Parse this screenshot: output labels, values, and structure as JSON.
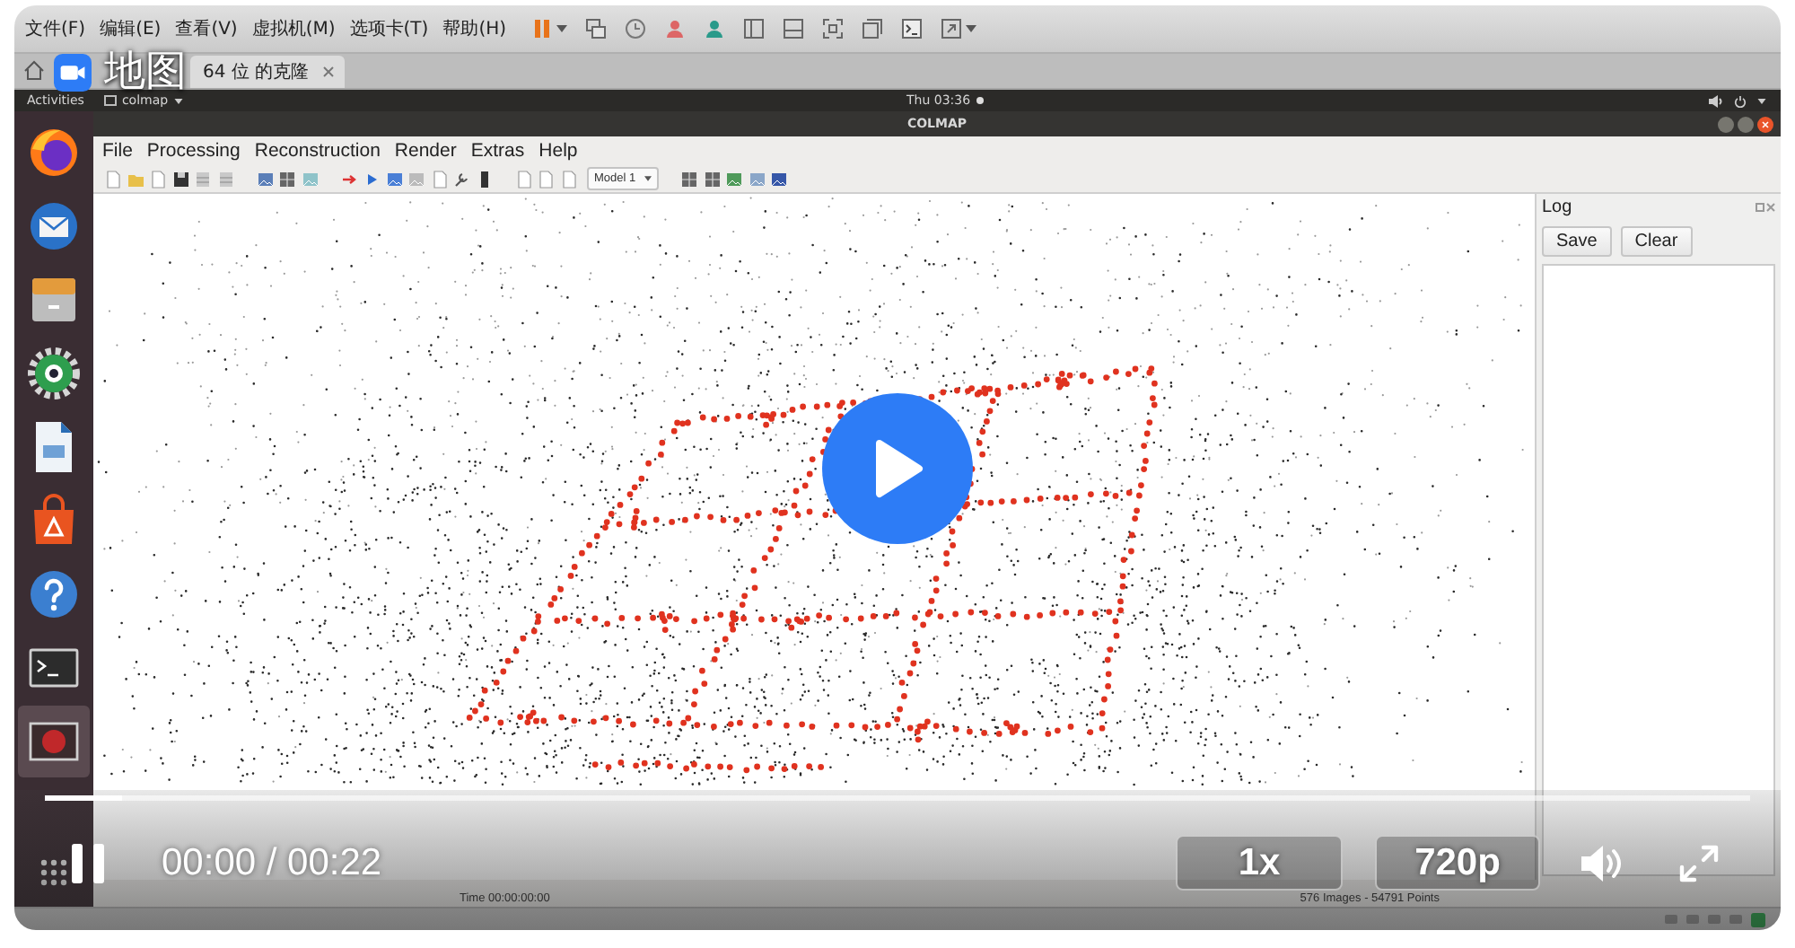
{
  "vm_menu": [
    "文件(F)",
    "编辑(E)",
    "查看(V)",
    "虚拟机(M)",
    "选项卡(T)",
    "帮助(H)"
  ],
  "vm_tabs": [
    {
      "kind": "home",
      "selected": false
    },
    {
      "kind": "machine",
      "label": "64 位 的克隆",
      "selected": true
    }
  ],
  "top_bar": {
    "activities": "Activities",
    "app_menu": "colmap",
    "clock": "Thu 03:36"
  },
  "dock_items": [
    {
      "selected": false
    },
    {
      "selected": false
    },
    {
      "selected": false
    },
    {
      "selected": false
    },
    {
      "selected": false
    },
    {
      "selected": false
    },
    {
      "selected": false
    },
    {
      "selected": false
    },
    {
      "selected": true
    }
  ],
  "colmap": {
    "title": "COLMAP",
    "menu": [
      "File",
      "Processing",
      "Reconstruction",
      "Render",
      "Extras",
      "Help"
    ],
    "model_select": "Model 1",
    "log": {
      "title": "Log",
      "buttons": [
        "Save",
        "Clear"
      ]
    },
    "status": {
      "time": "Time 00:00:00:00",
      "stats": "576 Images - 54791 Points"
    }
  },
  "video": {
    "title": "地图",
    "time": "00:00 / 00:22",
    "progress": {
      "level": 0.045
    },
    "speed": "1x",
    "quality": "720p"
  }
}
